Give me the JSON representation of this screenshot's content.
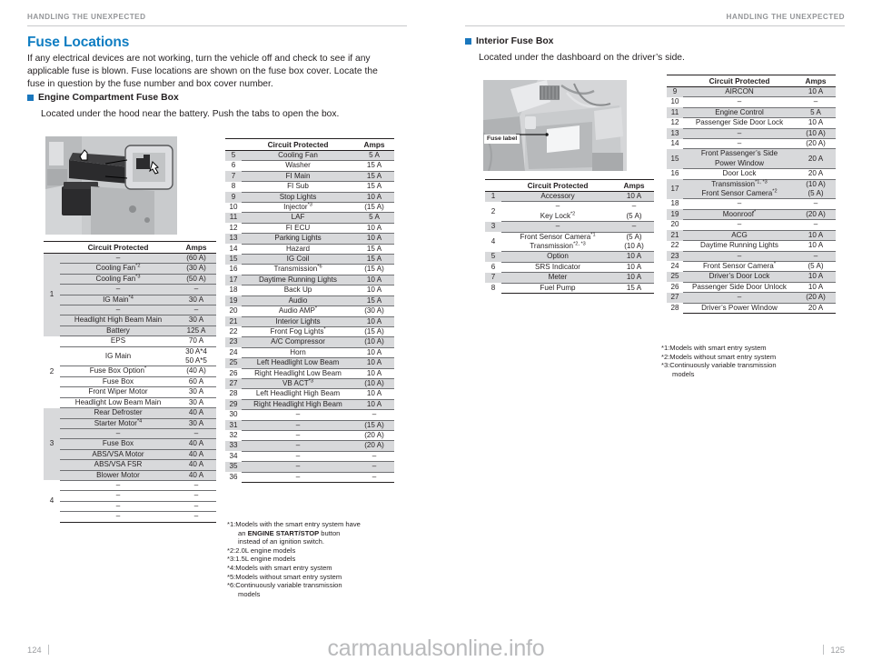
{
  "running_head": "HANDLING THE UNEXPECTED",
  "left_page": {
    "title": "Fuse Locations",
    "intro": "If any electrical devices are not working, turn the vehicle off and check to see if any applicable fuse is blown. Fuse locations are shown on the fuse box cover. Locate the fuse in question by the fuse number and box cover number.",
    "section_heading": "Engine Compartment Fuse Box",
    "section_sub": "Located under the hood near the battery. Push the tabs to open the box.",
    "folio": "124"
  },
  "right_page": {
    "section_heading": "Interior Fuse Box",
    "section_sub": "Located under the dashboard on the driver’s side.",
    "photo_callout": "Fuse label",
    "folio": "125"
  },
  "table_headers": {
    "num": "",
    "circuit": "Circuit Protected",
    "amps": "Amps"
  },
  "engine_main_table": [
    {
      "group": "1",
      "rows": [
        {
          "name": "–",
          "amps": "(60 A)"
        },
        {
          "name": "Cooling Fan *2",
          "amps": "(30 A)"
        },
        {
          "name": "Cooling Fan *3",
          "amps": "(50 A)"
        },
        {
          "name": "–",
          "amps": "–"
        },
        {
          "name": "IG Main *4",
          "amps": "30 A"
        },
        {
          "name": "–",
          "amps": "–"
        },
        {
          "name": "Headlight High Beam Main",
          "amps": "30 A"
        },
        {
          "name": "Battery",
          "amps": "125 A"
        }
      ],
      "shaded": true
    },
    {
      "group": "2",
      "rows": [
        {
          "name": "EPS",
          "amps": "70 A"
        },
        {
          "name": "IG Main",
          "amps": "30 A*4|50 A*5"
        },
        {
          "name": "Fuse Box Option *",
          "amps": "(40 A)"
        },
        {
          "name": "Fuse Box",
          "amps": "60 A"
        },
        {
          "name": "Front Wiper Motor",
          "amps": "30 A"
        },
        {
          "name": "Headlight Low Beam Main",
          "amps": "30 A"
        }
      ],
      "shaded": false
    },
    {
      "group": "3",
      "rows": [
        {
          "name": "Rear Defroster",
          "amps": "40 A"
        },
        {
          "name": "Starter Motor *4",
          "amps": "30 A"
        },
        {
          "name": "–",
          "amps": "–"
        },
        {
          "name": "Fuse Box",
          "amps": "40 A"
        },
        {
          "name": "ABS/VSA Motor",
          "amps": "40 A"
        },
        {
          "name": "ABS/VSA FSR",
          "amps": "40 A"
        },
        {
          "name": "Blower Motor",
          "amps": "40 A"
        }
      ],
      "shaded": true
    },
    {
      "group": "4",
      "rows": [
        {
          "name": "–",
          "amps": "–"
        },
        {
          "name": "–",
          "amps": "–"
        },
        {
          "name": "–",
          "amps": "–"
        },
        {
          "name": "–",
          "amps": "–"
        }
      ],
      "shaded": false
    }
  ],
  "engine_numbered_table": [
    {
      "num": "5",
      "name": "Cooling Fan",
      "amps": "5 A"
    },
    {
      "num": "6",
      "name": "Washer",
      "amps": "15 A"
    },
    {
      "num": "7",
      "name": "FI Main",
      "amps": "15 A"
    },
    {
      "num": "8",
      "name": "FI Sub",
      "amps": "15 A"
    },
    {
      "num": "9",
      "name": "Stop Lights",
      "amps": "10 A"
    },
    {
      "num": "10",
      "name": "Injector *3",
      "amps": "(15 A)"
    },
    {
      "num": "11",
      "name": "LAF",
      "amps": "5 A"
    },
    {
      "num": "12",
      "name": "FI ECU",
      "amps": "10 A"
    },
    {
      "num": "13",
      "name": "Parking Lights",
      "amps": "10 A"
    },
    {
      "num": "14",
      "name": "Hazard",
      "amps": "15 A"
    },
    {
      "num": "15",
      "name": "IG Coil",
      "amps": "15 A"
    },
    {
      "num": "16",
      "name": "Transmission *6",
      "amps": "(15 A)"
    },
    {
      "num": "17",
      "name": "Daytime Running Lights",
      "amps": "10 A"
    },
    {
      "num": "18",
      "name": "Back Up",
      "amps": "10 A"
    },
    {
      "num": "19",
      "name": "Audio",
      "amps": "15 A"
    },
    {
      "num": "20",
      "name": "Audio AMP *",
      "amps": "(30 A)"
    },
    {
      "num": "21",
      "name": "Interior Lights",
      "amps": "10 A"
    },
    {
      "num": "22",
      "name": "Front Fog Lights *",
      "amps": "(15 A)"
    },
    {
      "num": "23",
      "name": "A/C Compressor",
      "amps": "(10 A)"
    },
    {
      "num": "24",
      "name": "Horn",
      "amps": "10 A"
    },
    {
      "num": "25",
      "name": "Left Headlight Low Beam",
      "amps": "10 A"
    },
    {
      "num": "26",
      "name": "Right Headlight Low Beam",
      "amps": "10 A"
    },
    {
      "num": "27",
      "name": "VB ACT *3",
      "amps": "(10 A)"
    },
    {
      "num": "28",
      "name": "Left Headlight High Beam",
      "amps": "10 A"
    },
    {
      "num": "29",
      "name": "Right Headlight High Beam",
      "amps": "10 A"
    },
    {
      "num": "30",
      "name": "–",
      "amps": "–"
    },
    {
      "num": "31",
      "name": "–",
      "amps": "(15 A)"
    },
    {
      "num": "32",
      "name": "–",
      "amps": "(20 A)"
    },
    {
      "num": "33",
      "name": "–",
      "amps": "(20 A)"
    },
    {
      "num": "34",
      "name": "–",
      "amps": "–"
    },
    {
      "num": "35",
      "name": "–",
      "amps": "–"
    },
    {
      "num": "36",
      "name": "–",
      "amps": "–"
    }
  ],
  "interior_table_a": [
    {
      "num": "1",
      "name": "Accessory",
      "amps": "10 A"
    },
    {
      "num": "2",
      "name": "–|Key Lock *2",
      "amps": "–|(5 A)"
    },
    {
      "num": "3",
      "name": "–",
      "amps": "–"
    },
    {
      "num": "4",
      "name": "Front Sensor Camera *1|Transmission *2, *3",
      "amps": "(5 A)|(10 A)"
    },
    {
      "num": "5",
      "name": "Option",
      "amps": "10 A"
    },
    {
      "num": "6",
      "name": "SRS Indicator",
      "amps": "10 A"
    },
    {
      "num": "7",
      "name": "Meter",
      "amps": "10 A"
    },
    {
      "num": "8",
      "name": "Fuel Pump",
      "amps": "15 A"
    }
  ],
  "interior_table_b": [
    {
      "num": "9",
      "name": "AIRCON",
      "amps": "10 A"
    },
    {
      "num": "10",
      "name": "–",
      "amps": "–"
    },
    {
      "num": "11",
      "name": "Engine Control",
      "amps": "5 A"
    },
    {
      "num": "12",
      "name": "Passenger Side Door Lock",
      "amps": "10 A"
    },
    {
      "num": "13",
      "name": "–",
      "amps": "(10 A)"
    },
    {
      "num": "14",
      "name": "–",
      "amps": "(20 A)"
    },
    {
      "num": "15",
      "name": "Front Passenger’s Side|Power Window",
      "amps": "20 A"
    },
    {
      "num": "16",
      "name": "Door Lock",
      "amps": "20 A"
    },
    {
      "num": "17",
      "name": "Transmission *1, *3|Front Sensor Camera *2",
      "amps": "(10 A)|(5 A)"
    },
    {
      "num": "18",
      "name": "–",
      "amps": "–"
    },
    {
      "num": "19",
      "name": "Moonroof *",
      "amps": "(20 A)"
    },
    {
      "num": "20",
      "name": "–",
      "amps": "–"
    },
    {
      "num": "21",
      "name": "ACG",
      "amps": "10 A"
    },
    {
      "num": "22",
      "name": "Daytime Running Lights",
      "amps": "10 A"
    },
    {
      "num": "23",
      "name": "–",
      "amps": "–"
    },
    {
      "num": "24",
      "name": "Front Sensor Camera *",
      "amps": "(5 A)"
    },
    {
      "num": "25",
      "name": "Driver’s Door Lock",
      "amps": "10 A"
    },
    {
      "num": "26",
      "name": "Passenger Side Door Unlock",
      "amps": "10 A"
    },
    {
      "num": "27",
      "name": "–",
      "amps": "(20 A)"
    },
    {
      "num": "28",
      "name": "Driver’s Power Window",
      "amps": "20 A"
    }
  ],
  "footnotes_left": [
    "*1:Models with the smart entry system have",
    "an ENGINE START/STOP button",
    "instead of an ignition switch.",
    "*2:2.0L engine models",
    "*3:1.5L engine models",
    "*4:Models with smart entry system",
    "*5:Models without smart entry system",
    "*6:Continuously variable transmission",
    "models"
  ],
  "footnotes_right": [
    "*1:Models with smart entry system",
    "*2:Models without smart entry system",
    "*3:Continuously variable transmission",
    "models"
  ],
  "watermark": "carmanualsonline.info",
  "colors": {
    "accent": "#0f7dc2",
    "marker": "#1a77bd",
    "shade": "#d8d9db",
    "rule": "#231f20",
    "runhead": "#949699"
  }
}
